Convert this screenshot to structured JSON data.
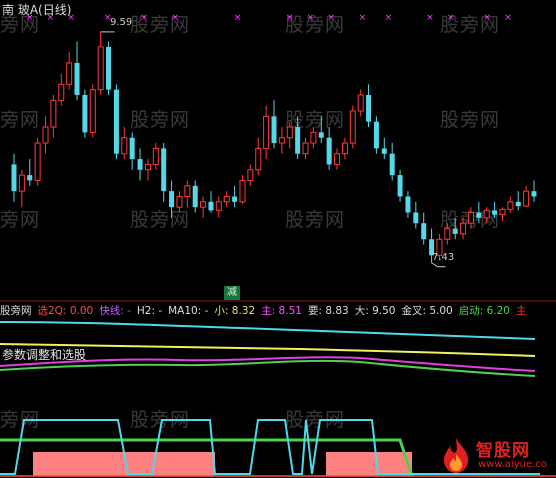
{
  "header": {
    "title": "南 玻A(日线)",
    "high_label": "9.59",
    "low_label": "7.43",
    "sell_tag": "减"
  },
  "watermark_text": "股旁网",
  "indicator_bar": {
    "items": [
      {
        "text": "股旁网",
        "color": "#dddddd"
      },
      {
        "text": "选2Q: 0.00",
        "color": "#ff4a4a"
      },
      {
        "text": "快线: -",
        "color": "#c060ff"
      },
      {
        "text": "H2: -",
        "color": "#dddddd"
      },
      {
        "text": "MA10: -",
        "color": "#dddddd"
      },
      {
        "text": "小: 8.32",
        "color": "#e6e650"
      },
      {
        "text": "主: 8.51",
        "color": "#ff50ff"
      },
      {
        "text": "要: 8.83",
        "color": "#dddddd"
      },
      {
        "text": "大: 9.50",
        "color": "#dddddd"
      },
      {
        "text": "金叉: 5.00",
        "color": "#dddddd"
      },
      {
        "text": "启动: 6.20",
        "color": "#50d050"
      },
      {
        "text": "主",
        "color": "#ff3030"
      }
    ]
  },
  "sub_note": "参数调整和选股",
  "logo": {
    "name": "智股网",
    "url": "www.aiyue.co"
  },
  "colors": {
    "up": "#ff3a3a",
    "down": "#56d8e8",
    "marker": "#ff40ff",
    "cyan_line": "#4fd8e8",
    "yellow_line": "#f0f060",
    "magenta_line": "#e040e0",
    "green_line": "#50d050",
    "signal_fill": "#ff8080"
  },
  "candles": [
    [
      8.35,
      8.45,
      8.0,
      8.1
    ],
    [
      8.1,
      8.3,
      7.95,
      8.25
    ],
    [
      8.25,
      8.4,
      8.15,
      8.2
    ],
    [
      8.2,
      8.6,
      8.15,
      8.55
    ],
    [
      8.55,
      8.8,
      8.45,
      8.7
    ],
    [
      8.7,
      9.0,
      8.6,
      8.95
    ],
    [
      8.95,
      9.2,
      8.9,
      9.1
    ],
    [
      9.1,
      9.4,
      9.05,
      9.3
    ],
    [
      9.3,
      9.5,
      8.95,
      9.0
    ],
    [
      9.0,
      9.05,
      8.6,
      8.65
    ],
    [
      8.65,
      9.1,
      8.6,
      9.05
    ],
    [
      9.05,
      9.59,
      9.0,
      9.45
    ],
    [
      9.45,
      9.5,
      9.0,
      9.05
    ],
    [
      9.05,
      9.1,
      8.4,
      8.45
    ],
    [
      8.45,
      8.7,
      8.4,
      8.6
    ],
    [
      8.6,
      8.65,
      8.3,
      8.4
    ],
    [
      8.4,
      8.5,
      8.2,
      8.3
    ],
    [
      8.3,
      8.4,
      8.2,
      8.35
    ],
    [
      8.35,
      8.55,
      8.3,
      8.5
    ],
    [
      8.5,
      8.55,
      8.0,
      8.1
    ],
    [
      8.1,
      8.2,
      7.85,
      7.95
    ],
    [
      7.95,
      8.1,
      7.9,
      8.05
    ],
    [
      8.05,
      8.2,
      7.95,
      8.15
    ],
    [
      8.15,
      8.2,
      7.9,
      7.95
    ],
    [
      7.95,
      8.05,
      7.85,
      8.0
    ],
    [
      8.0,
      8.1,
      7.9,
      7.92
    ],
    [
      7.92,
      8.05,
      7.85,
      8.0
    ],
    [
      8.0,
      8.1,
      7.95,
      8.05
    ],
    [
      8.05,
      8.15,
      7.95,
      8.0
    ],
    [
      8.0,
      8.25,
      7.98,
      8.2
    ],
    [
      8.2,
      8.35,
      8.15,
      8.3
    ],
    [
      8.3,
      8.6,
      8.25,
      8.5
    ],
    [
      8.5,
      8.9,
      8.4,
      8.8
    ],
    [
      8.8,
      8.95,
      8.5,
      8.55
    ],
    [
      8.55,
      8.7,
      8.45,
      8.6
    ],
    [
      8.6,
      8.75,
      8.5,
      8.7
    ],
    [
      8.7,
      8.8,
      8.4,
      8.45
    ],
    [
      8.45,
      8.6,
      8.4,
      8.55
    ],
    [
      8.55,
      8.7,
      8.5,
      8.65
    ],
    [
      8.65,
      8.8,
      8.55,
      8.6
    ],
    [
      8.6,
      8.7,
      8.3,
      8.35
    ],
    [
      8.35,
      8.5,
      8.3,
      8.45
    ],
    [
      8.45,
      8.6,
      8.4,
      8.55
    ],
    [
      8.55,
      8.9,
      8.5,
      8.85
    ],
    [
      8.85,
      9.05,
      8.8,
      9.0
    ],
    [
      9.0,
      9.1,
      8.7,
      8.75
    ],
    [
      8.75,
      8.8,
      8.45,
      8.5
    ],
    [
      8.5,
      8.6,
      8.4,
      8.45
    ],
    [
      8.45,
      8.55,
      8.2,
      8.25
    ],
    [
      8.25,
      8.3,
      8.0,
      8.05
    ],
    [
      8.05,
      8.1,
      7.85,
      7.9
    ],
    [
      7.9,
      8.0,
      7.75,
      7.8
    ],
    [
      7.8,
      7.9,
      7.6,
      7.65
    ],
    [
      7.65,
      7.75,
      7.43,
      7.5
    ],
    [
      7.5,
      7.7,
      7.45,
      7.65
    ],
    [
      7.65,
      7.8,
      7.6,
      7.75
    ],
    [
      7.75,
      7.85,
      7.65,
      7.7
    ],
    [
      7.7,
      7.85,
      7.65,
      7.8
    ],
    [
      7.8,
      7.95,
      7.75,
      7.9
    ],
    [
      7.9,
      8.0,
      7.8,
      7.85
    ],
    [
      7.85,
      7.95,
      7.8,
      7.92
    ],
    [
      7.92,
      8.0,
      7.85,
      7.88
    ],
    [
      7.88,
      7.95,
      7.82,
      7.93
    ],
    [
      7.93,
      8.05,
      7.9,
      8.0
    ],
    [
      8.0,
      8.1,
      7.92,
      7.96
    ],
    [
      7.96,
      8.15,
      7.95,
      8.1
    ],
    [
      8.1,
      8.2,
      8.0,
      8.05
    ]
  ],
  "markers": [
    0.03,
    0.07,
    0.11,
    0.18,
    0.25,
    0.31,
    0.43,
    0.53,
    0.57,
    0.61,
    0.67,
    0.72,
    0.8,
    0.84,
    0.91,
    0.95
  ]
}
